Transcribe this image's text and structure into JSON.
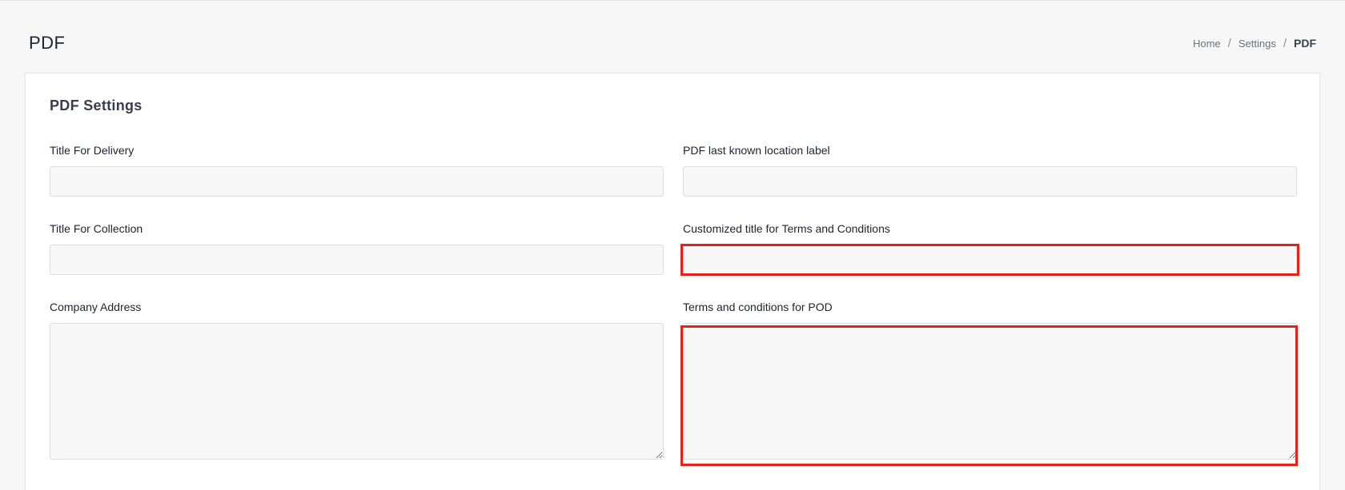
{
  "header": {
    "title": "PDF",
    "breadcrumb": {
      "home": "Home",
      "settings": "Settings",
      "current": "PDF",
      "separator": "/"
    }
  },
  "card": {
    "title": "PDF Settings",
    "fields": {
      "title_for_delivery": {
        "label": "Title For Delivery",
        "value": ""
      },
      "pdf_last_known_location_label": {
        "label": "PDF last known location label",
        "value": ""
      },
      "title_for_collection": {
        "label": "Title For Collection",
        "value": ""
      },
      "customized_title_terms": {
        "label": "Customized title for Terms and Conditions",
        "value": ""
      },
      "company_address": {
        "label": "Company Address",
        "value": ""
      },
      "terms_conditions_pod": {
        "label": "Terms and conditions for POD",
        "value": ""
      }
    }
  },
  "colors": {
    "highlight": "#e3221b",
    "input_background": "#f7f7f7",
    "page_background": "#f7f7f7"
  }
}
